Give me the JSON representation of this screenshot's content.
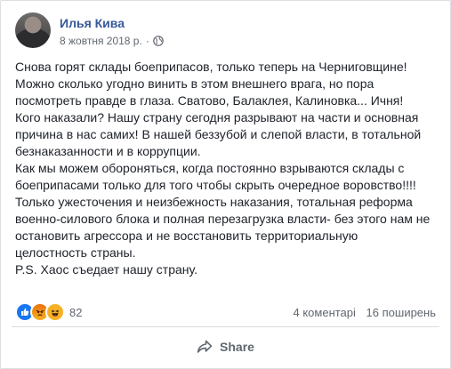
{
  "post": {
    "author": "Илья Кива",
    "date": "8 жовтня 2018 р.",
    "separator": "·",
    "privacy_icon": "globe-icon",
    "text_lines": [
      "Снова горят склады боеприпасов, только теперь на Черниговщине!",
      "Можно сколько угодно винить в этом внешнего врага, но пора",
      "посмотреть правде в глаза. Сватово, Балаклея, Калиновка... Ичня!",
      "Кого наказали? Нашу страну сегодня разрывают на части и основная",
      "причина в нас самих! В нашей беззубой и слепой власти, в тотальной",
      "безнаказанности и в коррупции.",
      "Как мы можем обороняться, когда постоянно взрываются склады с",
      "боеприпасами только для того чтобы скрыть очередное воровство!!!!",
      "Только ужесточения и неизбежность наказания, тотальная реформа",
      "военно-силового блока и полная перезагрузка власти- без этого нам не",
      "остановить агрессора и не восстановить территориальную",
      "целостность страны.",
      "P.S. Хаос съедает нашу страну."
    ]
  },
  "reactions": {
    "icons": [
      "like-icon",
      "angry-icon",
      "haha-icon"
    ],
    "count": "82"
  },
  "stats": {
    "comments": "4 коментарі",
    "shares": "16 поширень"
  },
  "actions": {
    "share_label": "Share"
  },
  "colors": {
    "author": "#385898",
    "text": "#1d2129",
    "meta": "#616770",
    "like": "#1877f2",
    "angry": "#e9710f",
    "haha": "#f7b125"
  }
}
